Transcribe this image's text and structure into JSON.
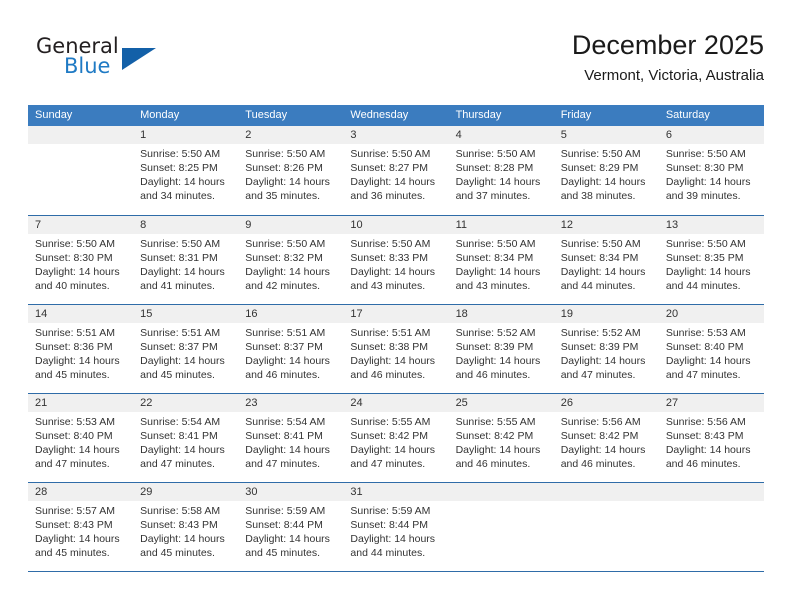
{
  "logo": {
    "word_top": "General",
    "word_bottom": "Blue",
    "triangle_icon": "logo-triangle-icon",
    "colors": {
      "dark": "#231f20",
      "blue": "#1f7ac4",
      "triangle": "#1360a8"
    }
  },
  "header": {
    "title": "December 2025",
    "subtitle": "Vermont, Victoria, Australia"
  },
  "theme": {
    "header_row_bg": "#3b7cbf",
    "header_row_text": "#ffffff",
    "daynum_band_bg": "#f0f0f0",
    "row_divider": "#2f6ca8",
    "body_text": "#333333"
  },
  "weekdays": [
    "Sunday",
    "Monday",
    "Tuesday",
    "Wednesday",
    "Thursday",
    "Friday",
    "Saturday"
  ],
  "weeks": [
    [
      {
        "day": "",
        "lines": [
          "",
          "",
          "",
          ""
        ]
      },
      {
        "day": "1",
        "lines": [
          "Sunrise: 5:50 AM",
          "Sunset: 8:25 PM",
          "Daylight: 14 hours",
          "and 34 minutes."
        ]
      },
      {
        "day": "2",
        "lines": [
          "Sunrise: 5:50 AM",
          "Sunset: 8:26 PM",
          "Daylight: 14 hours",
          "and 35 minutes."
        ]
      },
      {
        "day": "3",
        "lines": [
          "Sunrise: 5:50 AM",
          "Sunset: 8:27 PM",
          "Daylight: 14 hours",
          "and 36 minutes."
        ]
      },
      {
        "day": "4",
        "lines": [
          "Sunrise: 5:50 AM",
          "Sunset: 8:28 PM",
          "Daylight: 14 hours",
          "and 37 minutes."
        ]
      },
      {
        "day": "5",
        "lines": [
          "Sunrise: 5:50 AM",
          "Sunset: 8:29 PM",
          "Daylight: 14 hours",
          "and 38 minutes."
        ]
      },
      {
        "day": "6",
        "lines": [
          "Sunrise: 5:50 AM",
          "Sunset: 8:30 PM",
          "Daylight: 14 hours",
          "and 39 minutes."
        ]
      }
    ],
    [
      {
        "day": "7",
        "lines": [
          "Sunrise: 5:50 AM",
          "Sunset: 8:30 PM",
          "Daylight: 14 hours",
          "and 40 minutes."
        ]
      },
      {
        "day": "8",
        "lines": [
          "Sunrise: 5:50 AM",
          "Sunset: 8:31 PM",
          "Daylight: 14 hours",
          "and 41 minutes."
        ]
      },
      {
        "day": "9",
        "lines": [
          "Sunrise: 5:50 AM",
          "Sunset: 8:32 PM",
          "Daylight: 14 hours",
          "and 42 minutes."
        ]
      },
      {
        "day": "10",
        "lines": [
          "Sunrise: 5:50 AM",
          "Sunset: 8:33 PM",
          "Daylight: 14 hours",
          "and 43 minutes."
        ]
      },
      {
        "day": "11",
        "lines": [
          "Sunrise: 5:50 AM",
          "Sunset: 8:34 PM",
          "Daylight: 14 hours",
          "and 43 minutes."
        ]
      },
      {
        "day": "12",
        "lines": [
          "Sunrise: 5:50 AM",
          "Sunset: 8:34 PM",
          "Daylight: 14 hours",
          "and 44 minutes."
        ]
      },
      {
        "day": "13",
        "lines": [
          "Sunrise: 5:50 AM",
          "Sunset: 8:35 PM",
          "Daylight: 14 hours",
          "and 44 minutes."
        ]
      }
    ],
    [
      {
        "day": "14",
        "lines": [
          "Sunrise: 5:51 AM",
          "Sunset: 8:36 PM",
          "Daylight: 14 hours",
          "and 45 minutes."
        ]
      },
      {
        "day": "15",
        "lines": [
          "Sunrise: 5:51 AM",
          "Sunset: 8:37 PM",
          "Daylight: 14 hours",
          "and 45 minutes."
        ]
      },
      {
        "day": "16",
        "lines": [
          "Sunrise: 5:51 AM",
          "Sunset: 8:37 PM",
          "Daylight: 14 hours",
          "and 46 minutes."
        ]
      },
      {
        "day": "17",
        "lines": [
          "Sunrise: 5:51 AM",
          "Sunset: 8:38 PM",
          "Daylight: 14 hours",
          "and 46 minutes."
        ]
      },
      {
        "day": "18",
        "lines": [
          "Sunrise: 5:52 AM",
          "Sunset: 8:39 PM",
          "Daylight: 14 hours",
          "and 46 minutes."
        ]
      },
      {
        "day": "19",
        "lines": [
          "Sunrise: 5:52 AM",
          "Sunset: 8:39 PM",
          "Daylight: 14 hours",
          "and 47 minutes."
        ]
      },
      {
        "day": "20",
        "lines": [
          "Sunrise: 5:53 AM",
          "Sunset: 8:40 PM",
          "Daylight: 14 hours",
          "and 47 minutes."
        ]
      }
    ],
    [
      {
        "day": "21",
        "lines": [
          "Sunrise: 5:53 AM",
          "Sunset: 8:40 PM",
          "Daylight: 14 hours",
          "and 47 minutes."
        ]
      },
      {
        "day": "22",
        "lines": [
          "Sunrise: 5:54 AM",
          "Sunset: 8:41 PM",
          "Daylight: 14 hours",
          "and 47 minutes."
        ]
      },
      {
        "day": "23",
        "lines": [
          "Sunrise: 5:54 AM",
          "Sunset: 8:41 PM",
          "Daylight: 14 hours",
          "and 47 minutes."
        ]
      },
      {
        "day": "24",
        "lines": [
          "Sunrise: 5:55 AM",
          "Sunset: 8:42 PM",
          "Daylight: 14 hours",
          "and 47 minutes."
        ]
      },
      {
        "day": "25",
        "lines": [
          "Sunrise: 5:55 AM",
          "Sunset: 8:42 PM",
          "Daylight: 14 hours",
          "and 46 minutes."
        ]
      },
      {
        "day": "26",
        "lines": [
          "Sunrise: 5:56 AM",
          "Sunset: 8:42 PM",
          "Daylight: 14 hours",
          "and 46 minutes."
        ]
      },
      {
        "day": "27",
        "lines": [
          "Sunrise: 5:56 AM",
          "Sunset: 8:43 PM",
          "Daylight: 14 hours",
          "and 46 minutes."
        ]
      }
    ],
    [
      {
        "day": "28",
        "lines": [
          "Sunrise: 5:57 AM",
          "Sunset: 8:43 PM",
          "Daylight: 14 hours",
          "and 45 minutes."
        ]
      },
      {
        "day": "29",
        "lines": [
          "Sunrise: 5:58 AM",
          "Sunset: 8:43 PM",
          "Daylight: 14 hours",
          "and 45 minutes."
        ]
      },
      {
        "day": "30",
        "lines": [
          "Sunrise: 5:59 AM",
          "Sunset: 8:44 PM",
          "Daylight: 14 hours",
          "and 45 minutes."
        ]
      },
      {
        "day": "31",
        "lines": [
          "Sunrise: 5:59 AM",
          "Sunset: 8:44 PM",
          "Daylight: 14 hours",
          "and 44 minutes."
        ]
      },
      {
        "day": "",
        "lines": [
          "",
          "",
          "",
          ""
        ]
      },
      {
        "day": "",
        "lines": [
          "",
          "",
          "",
          ""
        ]
      },
      {
        "day": "",
        "lines": [
          "",
          "",
          "",
          ""
        ]
      }
    ]
  ]
}
